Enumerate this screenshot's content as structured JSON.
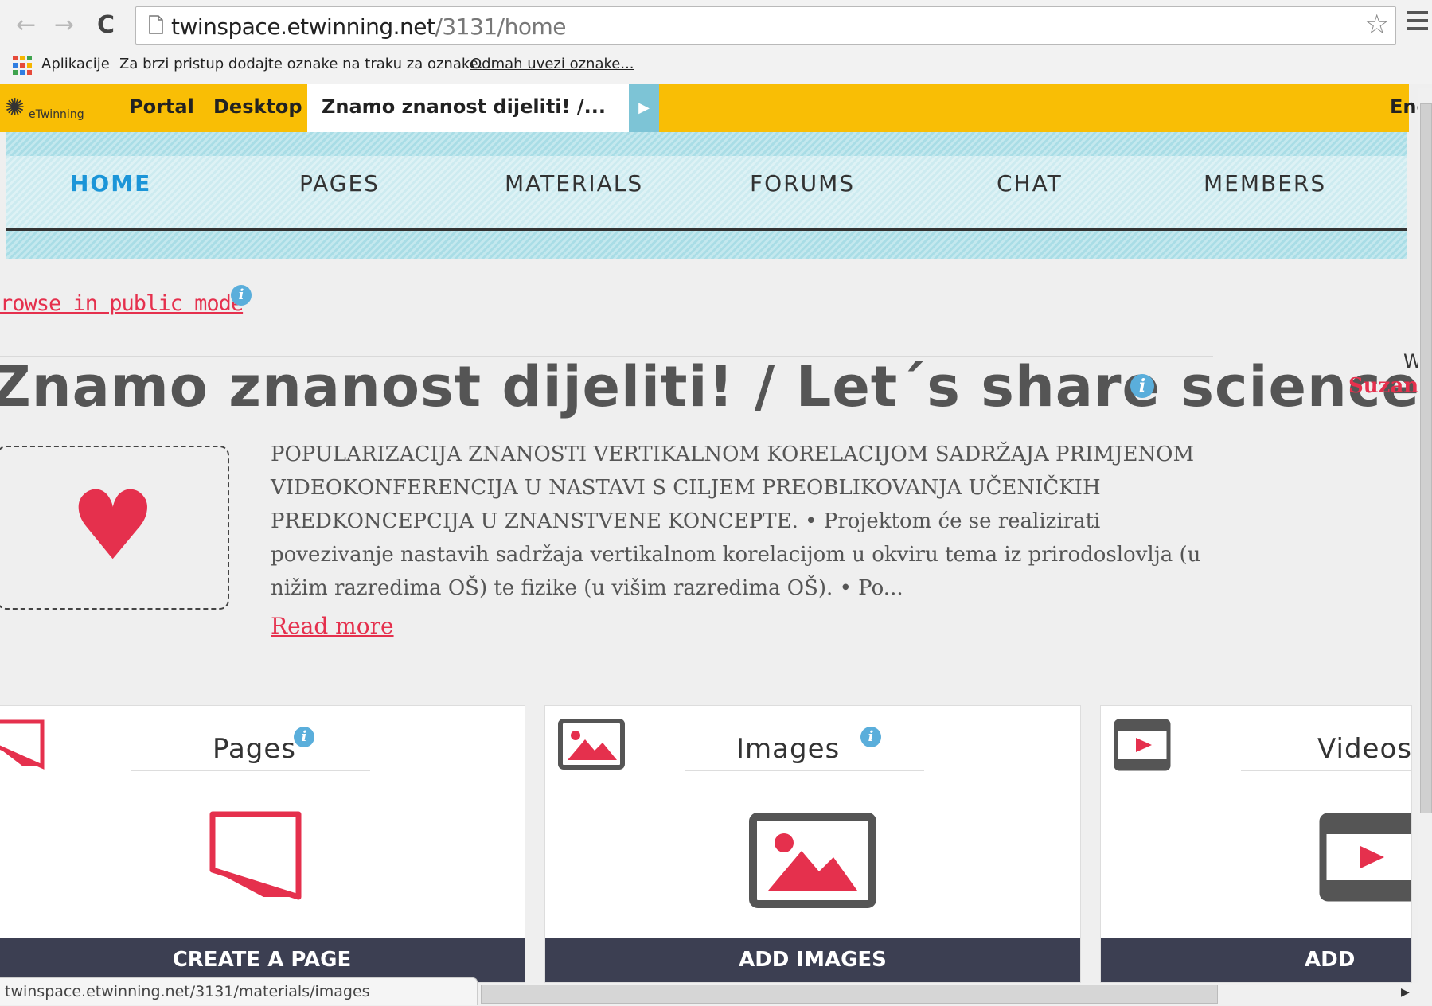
{
  "browser": {
    "url_host": "twinspace.etwinning.net",
    "url_path": "/3131/home",
    "bookmarks_apps_label": "Aplikacije",
    "bookmarks_hint": "Za brzi pristup dodajte oznake na traku za oznake.",
    "bookmarks_import_link": "Odmah uvezi oznake..."
  },
  "etwinning_bar": {
    "logo_text": "eTwinning",
    "portal_label": "Portal",
    "desktop_label": "Desktop",
    "active_tab_label": "Znamo znanost dijeliti! /...",
    "language_label": "Eng"
  },
  "twinspace_nav": {
    "home": "HOME",
    "pages": "PAGES",
    "materials": "MATERIALS",
    "forums": "FORUMS",
    "chat": "CHAT",
    "members": "MEMBERS"
  },
  "content": {
    "public_mode_link": "rowse in public mode",
    "project_title": "Znamo znanost dijeliti! / Let´s share science",
    "welcome_text": "W",
    "owner_name": "Suzana",
    "description": "POPULARIZACIJA ZNANOSTI VERTIKALNOM KORELACIJOM SADRŽAJA PRIMJENOM VIDEOKONFERENCIJA U NASTAVI S CILJEM PREOBLIKOVANJA UČENIČKIH PREDKONCEPCIJA U ZNANSTVENE KONCEPTE. • Projektom će se realizirati povezivanje nastavih sadržaja vertikalnom korelacijom u okviru tema iz prirodoslovlja (u nižim razredima OŠ) te fizike (u višim razredima OŠ). • Po...",
    "read_more": "Read more"
  },
  "cards": {
    "pages": {
      "title": "Pages",
      "button": "CREATE A PAGE"
    },
    "images": {
      "title": "Images",
      "button": "ADD IMAGES"
    },
    "videos": {
      "title": "Videos",
      "button": "ADD VIDEO"
    }
  },
  "status_bar": {
    "url": "twinspace.etwinning.net/3131/materials/images"
  },
  "colors": {
    "etwinning_yellow": "#f9be05",
    "accent_red": "#e5304d",
    "nav_active_blue": "#1b95d8",
    "button_dark": "#3c3f52"
  },
  "icons": {
    "back": "arrow-left-icon",
    "forward": "arrow-right-icon",
    "reload": "reload-icon",
    "star": "star-icon",
    "menu": "hamburger-menu-icon",
    "heart": "heart-icon",
    "pages": "page-icon",
    "images": "image-icon",
    "videos": "video-icon",
    "info": "info-icon"
  }
}
